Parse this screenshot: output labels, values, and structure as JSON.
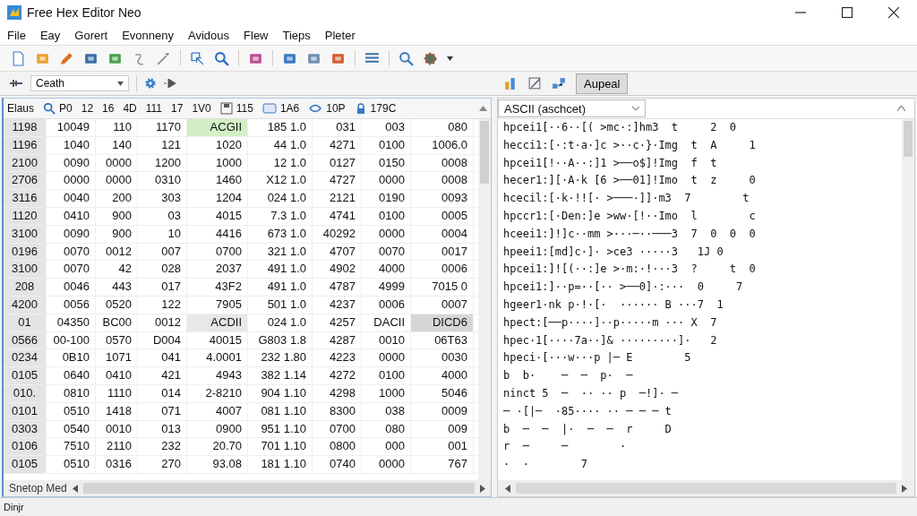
{
  "window": {
    "title": "Free Hex Editor Neo"
  },
  "menu": [
    "File",
    "Eay",
    "Gorert",
    "Evonneny",
    "Avidous",
    "Flew",
    "Tieps",
    "Pleter"
  ],
  "toolbar2": {
    "dropdown": "Ceath"
  },
  "hex_panel": {
    "header": [
      {
        "kind": "text",
        "label": "Elaus"
      },
      {
        "kind": "icon",
        "label": "P0"
      },
      {
        "kind": "text",
        "label": "12"
      },
      {
        "kind": "text",
        "label": "16"
      },
      {
        "kind": "text",
        "label": "4D"
      },
      {
        "kind": "text",
        "label": "111"
      },
      {
        "kind": "text",
        "label": "17"
      },
      {
        "kind": "text",
        "label": "1V0"
      },
      {
        "kind": "icon",
        "label": "115"
      },
      {
        "kind": "icon",
        "label": "1A6"
      },
      {
        "kind": "icon",
        "label": "10P"
      },
      {
        "kind": "icon",
        "label": "179C"
      }
    ],
    "rows": [
      {
        "cells": [
          "1198",
          "10049",
          "110",
          "1170",
          {
            "text": "ACGII",
            "color": "#d3efc6"
          },
          "185 1.0",
          "031",
          "003",
          "080"
        ]
      },
      {
        "cells": [
          "1196",
          "1040",
          "140",
          "121",
          "1020",
          "44 1.0",
          "4271",
          "0100",
          "1006.0"
        ]
      },
      {
        "cells": [
          "2100",
          "0090",
          "0000",
          "1200",
          "1000",
          "12 1.0",
          "0127",
          "0150",
          "0008"
        ]
      },
      {
        "cells": [
          "2706",
          "0000",
          "0000",
          "0310",
          "1460",
          "X12 1.0",
          "4727",
          "0000",
          "0008"
        ]
      },
      {
        "cells": [
          "3116",
          "0040",
          "200",
          "303",
          "1204",
          "024 1.0",
          "2121",
          "0190",
          "0093"
        ]
      },
      {
        "cells": [
          "1120",
          "0410",
          "900",
          "03",
          "4015",
          "7.3 1.0",
          "4741",
          "0100",
          "0005"
        ]
      },
      {
        "cells": [
          "3100",
          "0090",
          "900",
          "10",
          "4416",
          "673 1.0",
          "40292",
          "0000",
          "0004"
        ]
      },
      {
        "cells": [
          "0196",
          "0070",
          "0012",
          "007",
          "0700",
          "321 1.0",
          "4707",
          "0070",
          "0017"
        ]
      },
      {
        "cells": [
          "3100",
          "0070",
          "42",
          "028",
          "2037",
          "491 1.0",
          "4902",
          "4000",
          "0006"
        ]
      },
      {
        "cells": [
          "208",
          "0046",
          "443",
          "017",
          "43F2",
          "491 1.0",
          "4787",
          "4999",
          "7015 0"
        ]
      },
      {
        "cells": [
          "4200",
          "0056",
          "0520",
          "122",
          "7905",
          "501 1.0",
          "4237",
          "0006",
          "0007"
        ]
      },
      {
        "cells": [
          "01",
          "04350",
          "BC00",
          "0012",
          {
            "text": "ACDII",
            "color": "#e8e8e8"
          },
          "024 1.0",
          "4257",
          "DACII",
          {
            "text": "DICD6",
            "color": "#d6d6d6"
          }
        ]
      },
      {
        "cells": [
          "0566",
          "00-100",
          "0570",
          "D004",
          "40015",
          "G803 1.8",
          "4287",
          "0010",
          "06T63"
        ]
      },
      {
        "cells": [
          "0234",
          "0B10",
          "1071",
          "041",
          "4.0001",
          "232 1.80",
          "4223",
          "0000",
          "0030"
        ]
      },
      {
        "cells": [
          "0105",
          "0640",
          "0410",
          "421",
          "4943",
          "382 1.14",
          "4272",
          "0100",
          "4000"
        ]
      },
      {
        "cells": [
          "010.",
          "0810",
          "1110",
          "014",
          "2-8210",
          "904 1.10",
          "4298",
          "1000",
          "5046"
        ]
      },
      {
        "cells": [
          "0101",
          "0510",
          "1418",
          "071",
          "4007",
          "081 1.10",
          "8300",
          "038",
          "0009"
        ]
      },
      {
        "cells": [
          "0303",
          "0540",
          "0010",
          "013",
          "0900",
          "951 1.10",
          "0700",
          "080",
          "009"
        ]
      },
      {
        "cells": [
          "0106",
          "7510",
          "2110",
          "232",
          "20.70",
          "701 1.10",
          "0800",
          "000",
          "001"
        ]
      },
      {
        "cells": [
          "0105",
          "0510",
          "0316",
          "270",
          "93.08",
          "181 1.10",
          "0740",
          "0000",
          "767"
        ]
      }
    ],
    "footer_tab": "Snetop Med"
  },
  "ascii_panel": {
    "button": {
      "label": "Aupeal",
      "selected": true
    },
    "dropdown": "ASCII (aschcet)",
    "rows": [
      "hpcei1[··6··[( >mc·:]hm3  t     2  0",
      "hecci1:[·:t·a·]c >··c·}·Img  t  A     1",
      "hpcei1[!··A··:]1 >──o$]!Img  f  t",
      "hecer1:][·A·k [6 >──01]!Imo  t  z     0",
      "hcecil:[·k·!![· >───·]]·m3  7        t",
      "hpccr1:[·Den:]e >ww·[!··Imo  l        c",
      "hceei1:]!]c··mm >···─··───3  7  0  0  0",
      "hpeei1:[md]c·]· >ce3 ·····3   1J 0",
      "hpcei1:]![(··:]e >·m:·!···3  ?     t  0",
      "hpcei1:]··p=··[·· >──0]·:···  0     7",
      "hgeer1·nk p·!·[·  ······ B ···7  1",
      "hpect:[──p····]··p·····m ··· X  7",
      "hpec·1[····7a··]& ·········]·   2",
      "hpeci·[···w···p |─ E        5",
      "b  b·    ─  ─  p·  ─",
      "ninct 5  ─  ·· ·· p  ─!]· ─",
      "─ ·[|─  ·85···· ·· ─ ─ ─ t",
      "b  ─  ─  |·  ─  ─  r     D",
      "r  ─     ─        ·",
      "·  ·        7"
    ]
  },
  "status_bar": "Dinjr"
}
